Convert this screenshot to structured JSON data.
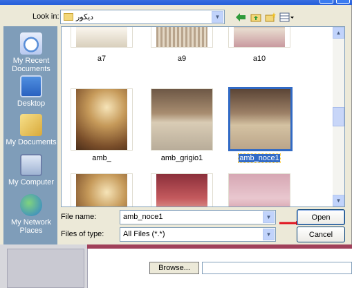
{
  "dialog": {
    "look_in_label": "Look in:",
    "look_in_value": "دیکور",
    "icons": [
      "back-icon",
      "up-folder-icon",
      "new-folder-icon",
      "views-menu-icon"
    ]
  },
  "places": [
    {
      "label": "My Recent Documents",
      "icon": "recent-documents-icon"
    },
    {
      "label": "Desktop",
      "icon": "desktop-icon"
    },
    {
      "label": "My Documents",
      "icon": "my-documents-icon"
    },
    {
      "label": "My Computer",
      "icon": "my-computer-icon"
    },
    {
      "label": "My Network Places",
      "icon": "network-places-icon"
    }
  ],
  "files": [
    {
      "name": "a7"
    },
    {
      "name": "a9"
    },
    {
      "name": "a10"
    },
    {
      "name": "amb_"
    },
    {
      "name": "amb_grigio1"
    },
    {
      "name": "amb_noce1",
      "selected": true
    },
    {
      "name": ""
    },
    {
      "name": ""
    },
    {
      "name": ""
    }
  ],
  "form": {
    "file_name_label": "File name:",
    "file_name_value": "amb_noce1",
    "file_type_label": "Files of type:",
    "file_type_value": "All Files (*.*)",
    "open_label": "Open",
    "cancel_label": "Cancel"
  },
  "page": {
    "browse_label": "Browse..."
  },
  "colors": {
    "selection": "#316ac5",
    "places_bar": "#7f9db9",
    "annotation_arrow": "#e0101c"
  }
}
